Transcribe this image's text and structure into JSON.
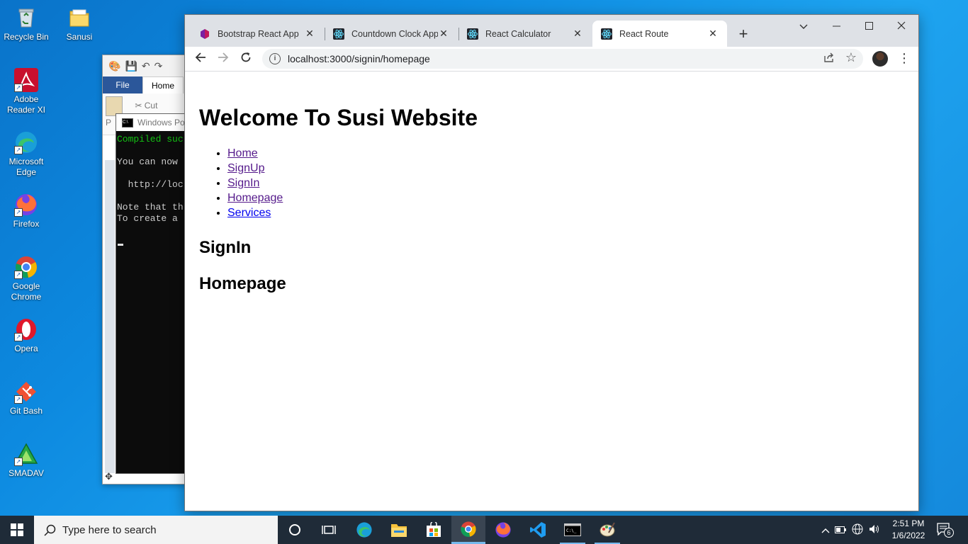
{
  "desktop": {
    "icons": [
      {
        "label": "Recycle Bin",
        "icon": "recycle-bin-icon"
      },
      {
        "label": "Sanusi",
        "icon": "folder-icon"
      },
      {
        "label": "Adobe Reader XI",
        "icon": "adobe-reader-icon"
      },
      {
        "label": "Microsoft Edge",
        "icon": "edge-icon"
      },
      {
        "label": "Firefox",
        "icon": "firefox-icon"
      },
      {
        "label": "Google Chrome",
        "icon": "chrome-icon"
      },
      {
        "label": "Opera",
        "icon": "opera-icon"
      },
      {
        "label": "Git Bash",
        "icon": "git-bash-icon"
      },
      {
        "label": "SMADAV",
        "icon": "smadav-icon"
      }
    ]
  },
  "background_windows": {
    "word": {
      "file_tab": "File",
      "home_tab": "Home",
      "cut_label": "Cut",
      "paste_label": "P"
    },
    "powershell": {
      "title": "Windows Po",
      "lines": [
        "Compiled suc",
        "",
        "You can now",
        "",
        "  http://loc",
        "",
        "Note that th",
        "To create a"
      ]
    }
  },
  "browser": {
    "tabs": [
      {
        "title": "Bootstrap React App",
        "icon": "bootstrap-icon",
        "active": false
      },
      {
        "title": "Countdown Clock App",
        "icon": "react-icon",
        "active": false
      },
      {
        "title": "React Calculator",
        "icon": "react-icon",
        "active": false
      },
      {
        "title": "React Route",
        "icon": "react-icon",
        "active": true
      }
    ],
    "url": "localhost:3000/signin/homepage",
    "page": {
      "heading": "Welcome To Susi Website",
      "nav_links": [
        "Home",
        "SignUp",
        "SignIn",
        "Homepage",
        "Services"
      ],
      "section1": "SignIn",
      "section2": "Homepage"
    }
  },
  "taskbar": {
    "search_placeholder": "Type here to search",
    "time": "2:51 PM",
    "date": "1/6/2022",
    "notification_count": "6"
  },
  "colors": {
    "link": "#0000ee",
    "link_visited": "#551a8b",
    "taskbar": "#1f2b38",
    "tab_strip": "#dee1e6"
  }
}
